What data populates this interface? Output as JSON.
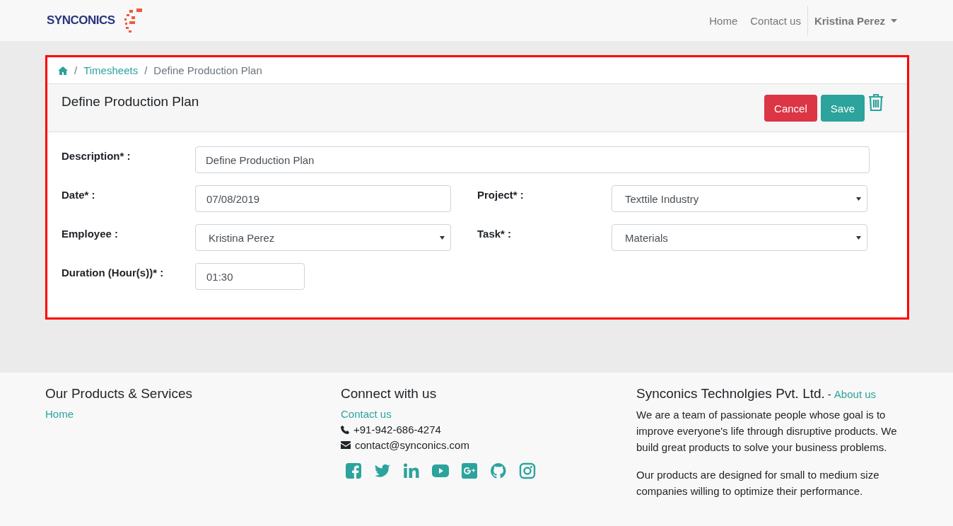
{
  "header": {
    "logo": "SYNCONICS",
    "nav": [
      {
        "label": "Home"
      },
      {
        "label": "Contact us"
      }
    ],
    "user": "Kristina Perez"
  },
  "breadcrumb": {
    "separator": "/",
    "items": [
      "Timesheets",
      "Define Production Plan"
    ]
  },
  "form": {
    "title": "Define Production Plan",
    "buttons": [
      {
        "label": "Cancel",
        "kind": "danger"
      },
      {
        "label": "Save",
        "kind": "primary"
      }
    ],
    "rows": [
      [
        {
          "label": "Description* :",
          "value": "Define Production Plan",
          "kind": "wide-text"
        }
      ],
      [
        {
          "label": "Date* :",
          "value": "07/08/2019",
          "kind": "text"
        },
        {
          "label": "Project* :",
          "value": "Texttile Industry",
          "kind": "select"
        }
      ],
      [
        {
          "label": "Employee :",
          "value": "Kristina Perez",
          "kind": "select"
        },
        {
          "label": "Task* :",
          "value": "Materials",
          "kind": "select"
        }
      ],
      [
        {
          "label": "Duration (Hour(s))* :",
          "value": "01:30",
          "kind": "short-text"
        }
      ]
    ]
  },
  "footer": {
    "products": {
      "title": "Our Products & Services",
      "links": [
        "Home"
      ]
    },
    "connect": {
      "title": "Connect with us",
      "link": "Contact us",
      "phone": "+91-942-686-4274",
      "email": "contact@synconics.com",
      "social": [
        {
          "kind": "facebook"
        },
        {
          "kind": "twitter"
        },
        {
          "kind": "linkedin"
        },
        {
          "kind": "youtube"
        },
        {
          "kind": "google-plus"
        },
        {
          "kind": "github"
        },
        {
          "kind": "instagram"
        }
      ]
    },
    "company": {
      "title": "Synconics Technolgies Pvt. Ltd.",
      "separator": "-",
      "link": "About us",
      "paragraphs": [
        "We are a team of passionate people whose goal is to improve everyone's life through disruptive products. We build great products to solve your business problems.",
        "Our products are designed for small to medium size companies willing to optimize their performance."
      ]
    }
  }
}
